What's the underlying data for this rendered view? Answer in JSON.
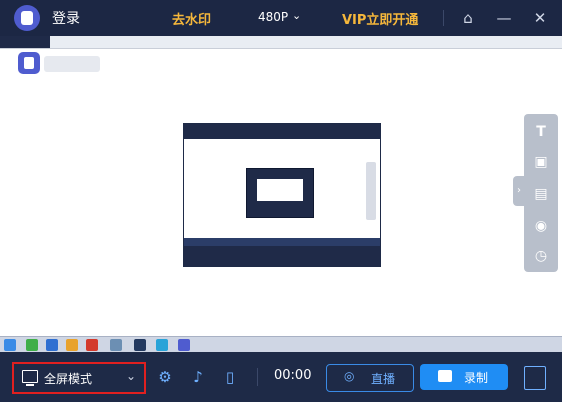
{
  "titlebar": {
    "login_label": "登录",
    "watermark_label": "去水印",
    "resolution": "480P",
    "vip_label": "VIP立即开通",
    "icons": [
      "app-logo-icon",
      "chevron-down-icon",
      "home-icon",
      "minimize-icon",
      "close-icon"
    ]
  },
  "toolbar": {
    "icons": [
      "text-icon",
      "image-icon",
      "camera-icon",
      "screenshot-icon",
      "timer-icon"
    ],
    "text_glyph": "T"
  },
  "bottombar": {
    "mode_label": "全屏模式",
    "timer": "00:00",
    "live_label": "直播",
    "record_label": "录制",
    "icons": [
      "monitor-icon",
      "gear-icon",
      "speaker-icon",
      "microphone-icon",
      "live-icon",
      "video-camera-icon",
      "layout-icon"
    ]
  },
  "colors": {
    "background": "#1e2a47",
    "accent_gold": "#f5b73b",
    "accent_blue": "#1f8df4",
    "highlight_red": "#e02020"
  }
}
